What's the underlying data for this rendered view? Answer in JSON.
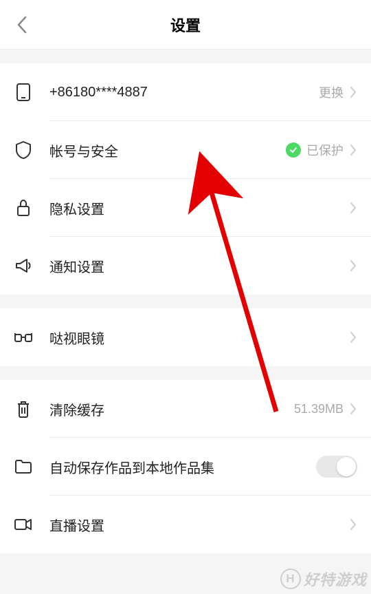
{
  "header": {
    "title": "设置"
  },
  "sections": [
    {
      "rows": [
        {
          "icon": "phone",
          "label": "+86180****4887",
          "value": "更换",
          "chevron": true
        },
        {
          "icon": "shield",
          "label": "帐号与安全",
          "badge": true,
          "value": "已保护",
          "chevron": true
        },
        {
          "icon": "lock",
          "label": "隐私设置",
          "chevron": true
        },
        {
          "icon": "megaphone",
          "label": "通知设置",
          "chevron": true
        }
      ]
    },
    {
      "rows": [
        {
          "icon": "glasses",
          "label": "哒视眼镜",
          "chevron": true
        }
      ]
    },
    {
      "rows": [
        {
          "icon": "trash",
          "label": "清除缓存",
          "value": "51.39MB",
          "chevron": true
        },
        {
          "icon": "folder",
          "label": "自动保存作品到本地作品集",
          "toggle": true
        },
        {
          "icon": "video",
          "label": "直播设置",
          "chevron": true
        }
      ]
    }
  ],
  "watermark": "好特游戏"
}
